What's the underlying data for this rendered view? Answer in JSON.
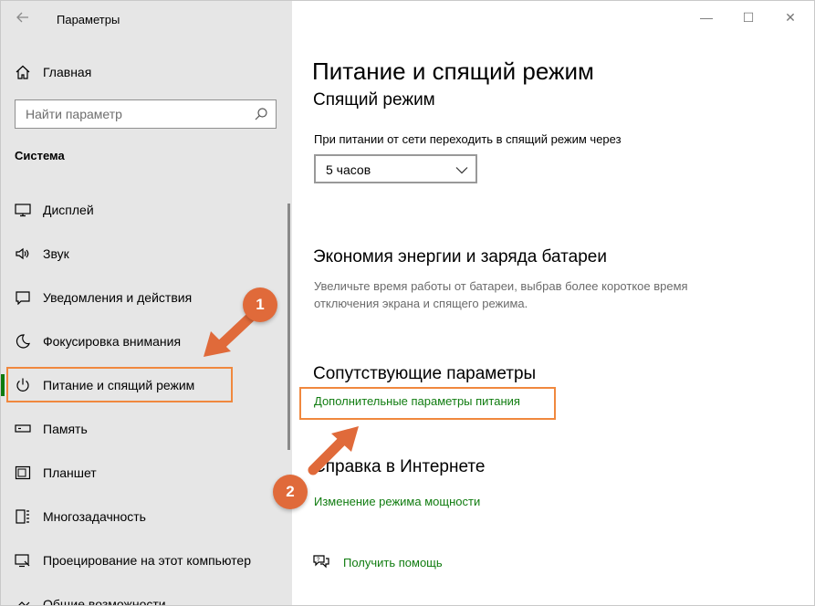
{
  "window": {
    "app_title": "Параметры",
    "controls": {
      "minimize": "—",
      "maximize": "☐",
      "close": "✕"
    }
  },
  "sidebar": {
    "home_label": "Главная",
    "search_placeholder": "Найти параметр",
    "section_title": "Система",
    "items": [
      {
        "label": "Дисплей",
        "icon": "display-icon"
      },
      {
        "label": "Звук",
        "icon": "sound-icon"
      },
      {
        "label": "Уведомления и действия",
        "icon": "notifications-icon"
      },
      {
        "label": "Фокусировка внимания",
        "icon": "focus-moon-icon"
      },
      {
        "label": "Питание и спящий режим",
        "icon": "power-icon",
        "active": true
      },
      {
        "label": "Память",
        "icon": "storage-icon"
      },
      {
        "label": "Планшет",
        "icon": "tablet-icon"
      },
      {
        "label": "Многозадачность",
        "icon": "multitasking-icon"
      },
      {
        "label": "Проецирование на этот компьютер",
        "icon": "projecting-icon"
      },
      {
        "label": "Общие возможности",
        "icon": "shared-icon"
      }
    ]
  },
  "main": {
    "page_title": "Питание и спящий режим",
    "sleep": {
      "heading": "Спящий режим",
      "label": "При питании от сети переходить в спящий режим через",
      "selected": "5 часов"
    },
    "battery": {
      "heading": "Экономия энергии и заряда батареи",
      "description": "Увеличьте время работы от батареи, выбрав более короткое время отключения экрана и спящего режима."
    },
    "related": {
      "heading": "Сопутствующие параметры",
      "link": "Дополнительные параметры питания"
    },
    "web_help": {
      "heading": "Справка в Интернете",
      "link": "Изменение режима мощности"
    },
    "get_help": "Получить помощь"
  },
  "annotations": {
    "badge_1": "1",
    "badge_2": "2",
    "accent_color": "#e06a3a"
  }
}
